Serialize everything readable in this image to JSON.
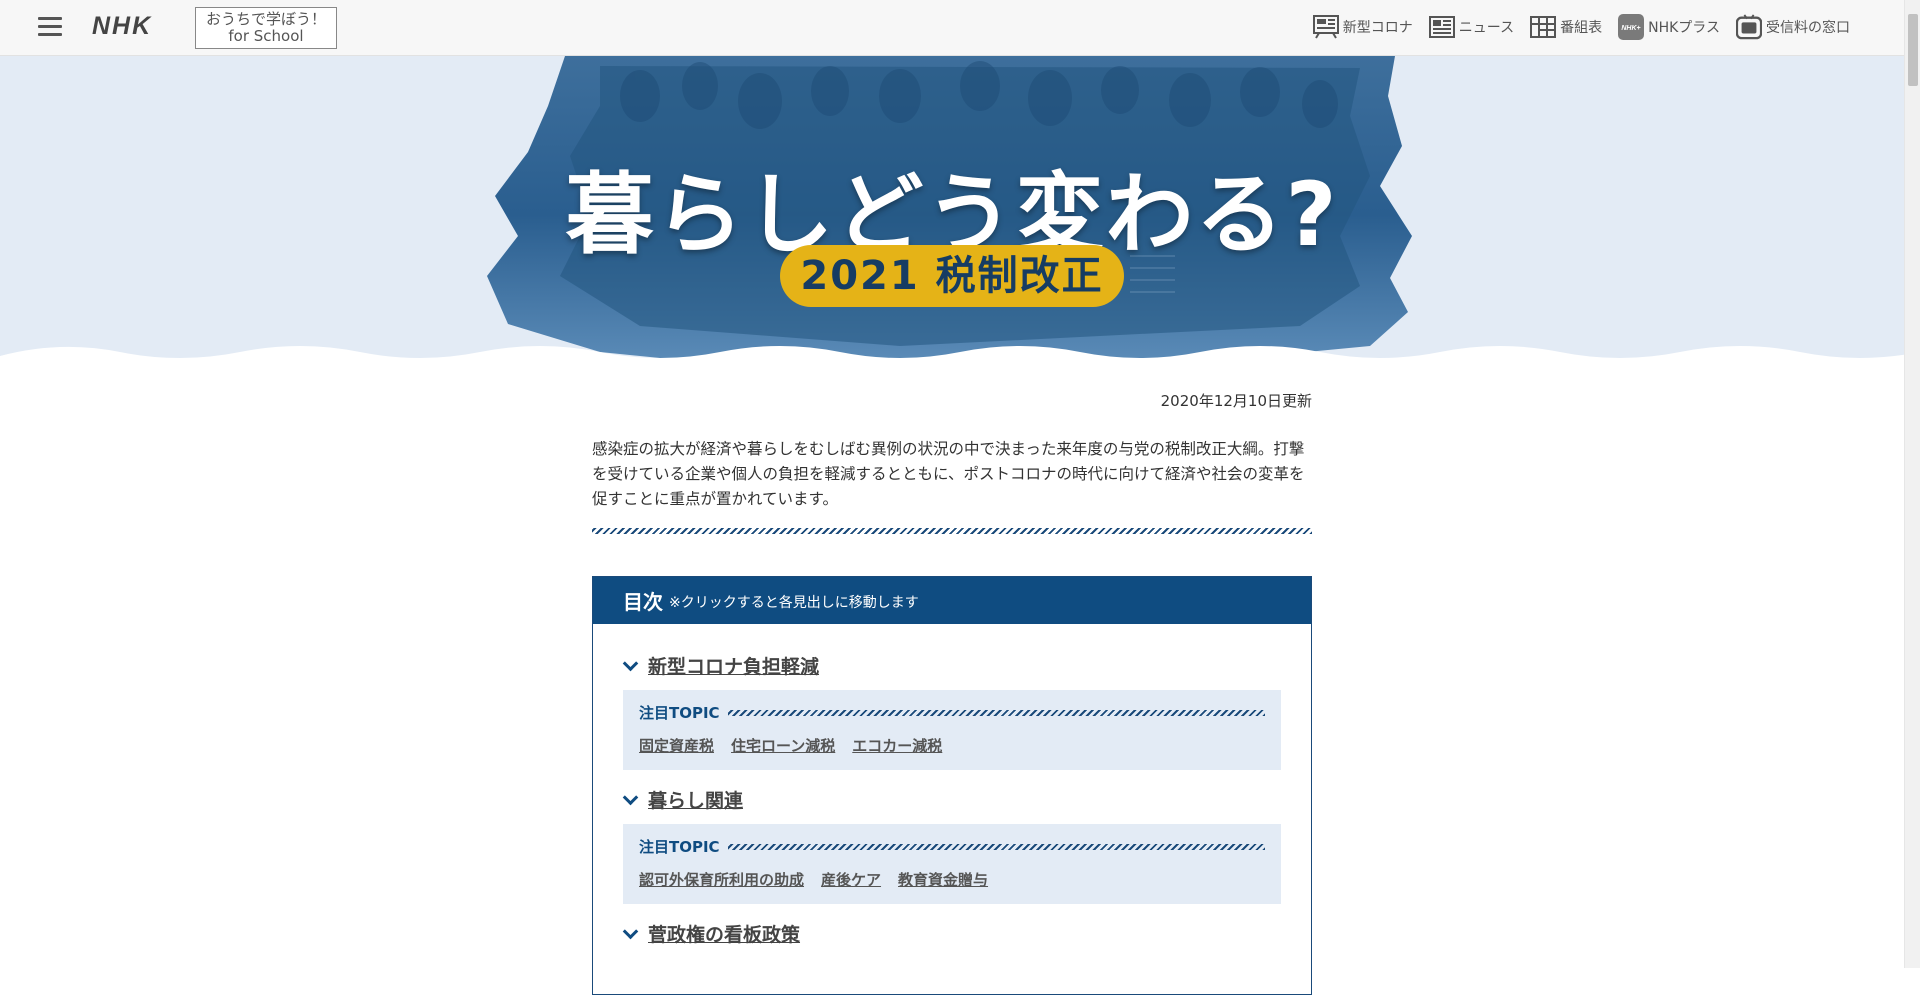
{
  "header": {
    "logo": "NHK",
    "school_line1": "おうちで学ぼう！",
    "school_line2": "for School",
    "nav": [
      {
        "label": "新型コロナ",
        "icon": "corona-board-icon"
      },
      {
        "label": "ニュース",
        "icon": "newspaper-icon"
      },
      {
        "label": "番組表",
        "icon": "program-grid-icon"
      },
      {
        "label": "NHKプラス",
        "icon": "nhk-plus-icon"
      },
      {
        "label": "受信料の窓口",
        "icon": "tv-window-icon"
      }
    ]
  },
  "hero": {
    "title": "暮らしどう変わる?",
    "badge": "2021 税制改正"
  },
  "article": {
    "updated": "2020年12月10日更新",
    "lead": "感染症の拡大が経済や暮らしをむしばむ異例の状況の中で決まった来年度の与党の税制改正大綱。打撃を受けている企業や個人の負担を軽減するとともに、ポストコロナの時代に向けて経済や社会の変革を促すことに重点が置かれています。"
  },
  "toc": {
    "title": "目次",
    "note": "※クリックすると各見出しに移動します",
    "sections": [
      {
        "label": "新型コロナ負担軽減",
        "topic_label": "注目TOPIC",
        "links": [
          "固定資産税",
          "住宅ローン減税",
          "エコカー減税"
        ]
      },
      {
        "label": "暮らし関連",
        "topic_label": "注目TOPIC",
        "links": [
          "認可外保育所利用の助成",
          "産後ケア",
          "教育資金贈与"
        ]
      },
      {
        "label": "菅政権の看板政策",
        "topic_label": "",
        "links": []
      }
    ]
  },
  "colors": {
    "accent_navy": "#0f4c81",
    "badge_yellow": "#e5b317",
    "hero_bg": "#e3ebf5"
  }
}
